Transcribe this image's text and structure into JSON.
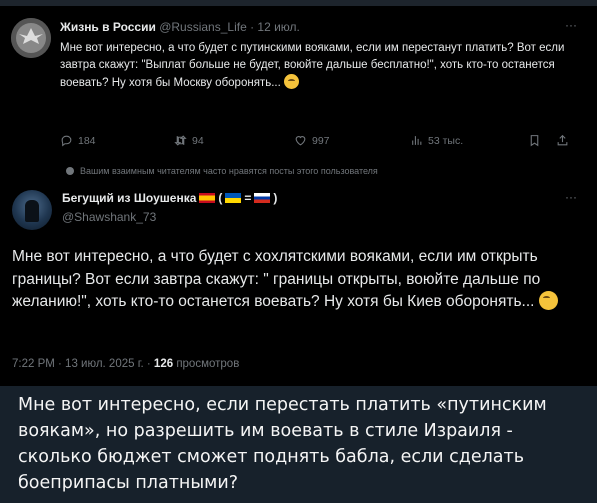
{
  "tweet1": {
    "author_name": "Жизнь в России",
    "handle": "@Russians_Life",
    "date": "· 12 июл.",
    "more": "···",
    "text": "Мне вот интересно, а что будет с путинскими вояками, если им перестанут платить? Вот если завтра скажут: \"Выплат больше не будет, воюйте дальше бесплатно!\", хоть кто-то останется воевать? Ну хотя бы Москву оборонять...",
    "replies": "184",
    "reposts": "94",
    "likes": "997",
    "views": "53 тыс."
  },
  "social_context": "Вашим взаимным читателям часто нравятся посты этого пользователя",
  "tweet2": {
    "author_name": "Бегущий из Шоушенка",
    "flags_suffix_open": "(",
    "flags_eq": "=",
    "flags_suffix_close": ")",
    "handle": "@Shawshank_73",
    "more": "···",
    "text": "Мне вот интересно, а что будет с хохлятскими вояками, если им открыть границы? Вот если завтра скажут: \" границы открыты, воюйте дальше по желанию!\", хоть кто-то останется воевать? Ну хотя бы Киев оборонять...",
    "time_date": "7:22 PM · 13 июл. 2025 г. ·",
    "views_count": "126",
    "views_label": "просмотров"
  },
  "caption": "Мне вот интересно, если перестать платить «путинским воякам», но разрешить им воевать в стиле Израиля - сколько бюджет сможет поднять бабла, если сделать боеприпасы платными?",
  "colors": {
    "x_bg": "#000000",
    "telegram_bg": "#17212b",
    "muted": "#71767b",
    "text": "#e7e9ea"
  }
}
